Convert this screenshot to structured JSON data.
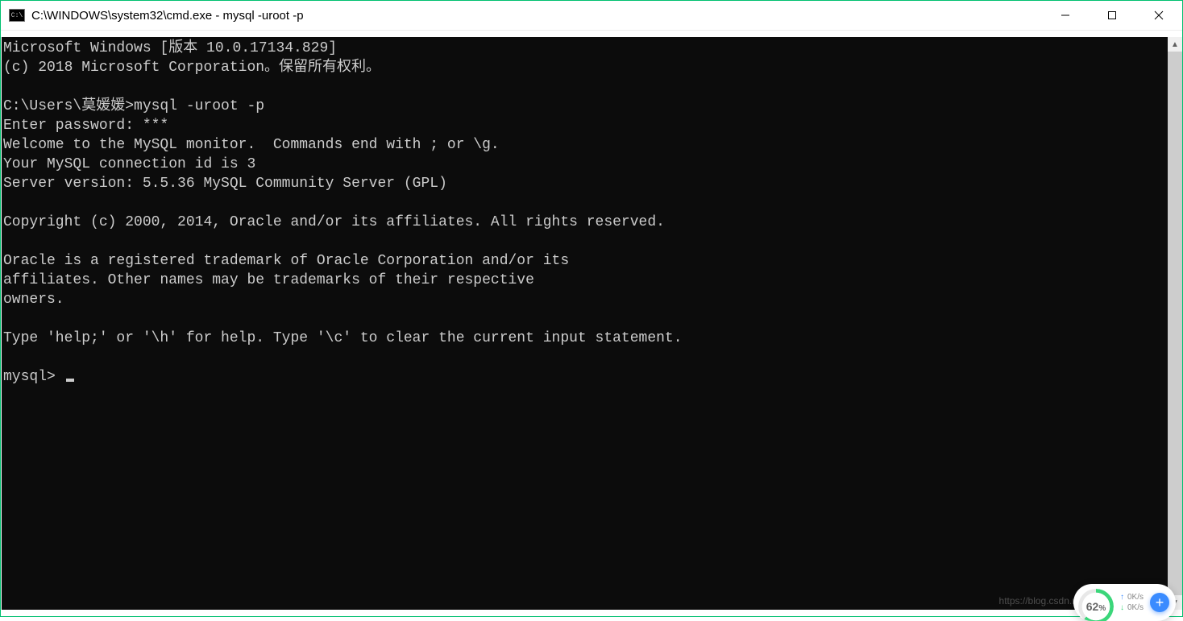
{
  "window": {
    "title": "C:\\WINDOWS\\system32\\cmd.exe - mysql  -uroot -p"
  },
  "terminal": {
    "lines": [
      "Microsoft Windows [版本 10.0.17134.829]",
      "(c) 2018 Microsoft Corporation。保留所有权利。",
      "",
      "C:\\Users\\莫媛媛>mysql -uroot -p",
      "Enter password: ***",
      "Welcome to the MySQL monitor.  Commands end with ; or \\g.",
      "Your MySQL connection id is 3",
      "Server version: 5.5.36 MySQL Community Server (GPL)",
      "",
      "Copyright (c) 2000, 2014, Oracle and/or its affiliates. All rights reserved.",
      "",
      "Oracle is a registered trademark of Oracle Corporation and/or its",
      "affiliates. Other names may be trademarks of their respective",
      "owners.",
      "",
      "Type 'help;' or '\\h' for help. Type '\\c' to clear the current input statement.",
      ""
    ],
    "prompt": "mysql> "
  },
  "widget": {
    "percent": "62",
    "percent_suffix": "%",
    "up_speed": "0K/s",
    "down_speed": "0K/s"
  },
  "watermark": "https://blog.csdn.net/qq_4424157"
}
